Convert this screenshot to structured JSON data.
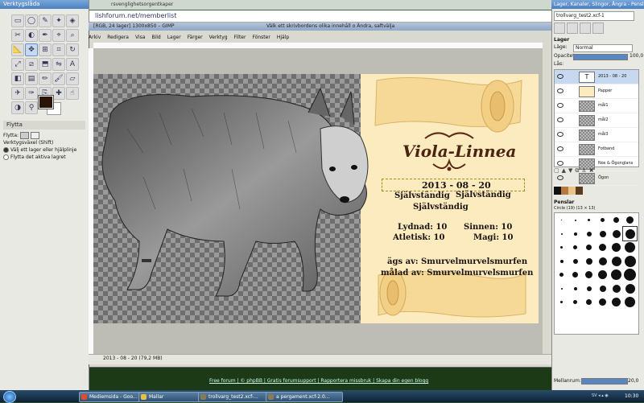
{
  "background_web": {
    "url": "lishforum.net/memberlist",
    "tab_label": "rsvenglighetsorgentkaper",
    "footer_links": "Free forum | © phpBB | Gratis forumsupport | Rapportera missbruk | Skapa din egen blogg"
  },
  "toolbox": {
    "title": "Verktygslåda",
    "options_title": "Flytta",
    "move_label": "Flytta:",
    "tool_switch_label": "Verktygsväxel (Shift)",
    "option_1": "Välj ett lager eller hjälplinje",
    "option_2": "Flytta det aktiva lagret",
    "tools": [
      "rect-select",
      "ellipse-select",
      "free-select",
      "fuzzy-select",
      "select-by-color",
      "scissors",
      "foreground-select",
      "paths",
      "color-picker",
      "zoom",
      "measure",
      "move",
      "align",
      "crop",
      "rotate",
      "scale",
      "shear",
      "perspective",
      "flip",
      "text",
      "bucket-fill",
      "blend",
      "pencil",
      "paintbrush",
      "eraser",
      "airbrush",
      "ink",
      "clone",
      "heal",
      "smudge",
      "dodge-burn",
      "dodge"
    ]
  },
  "image_window": {
    "title": "[RGB, 24 lager] 1300x850 – GIMP",
    "sub_title": "Välk ett skrivbordens olika innehåll o Ändra, saftvälja",
    "menu": [
      "Arkiv",
      "Redigera",
      "Visa",
      "Bild",
      "Lager",
      "Färger",
      "Verktyg",
      "Filter",
      "Fönster",
      "Hjälp"
    ],
    "status": "2013 - 08 - 20 (79,2 MB)"
  },
  "scroll": {
    "name": "Viola-Linnea",
    "date": "2013 - 08 - 20",
    "status_1": "Självständig",
    "status_2": "Självständig",
    "status_3": "Självständig",
    "lydnad": "Lydnad:  10",
    "atletisk": "Atletisk:  10",
    "sinnen": "Sinnen:  10",
    "magi": "Magi:  10",
    "owner": "ägs av: Smurvelmurvelsmurfen",
    "painter": "målad av: Smurvelmurvelsmurfen"
  },
  "dock": {
    "title": "Lager, Kanaler, Slingor, Ångra - Penslar, ...",
    "image_select": "trollvarg_test2.xcf-1",
    "layers_label": "Lager",
    "mode_label": "Läge:",
    "mode_value": "Normal",
    "opacity_label": "Opacitet:",
    "opacity_value": "100,0",
    "lock_label": "Lås:",
    "layers": [
      {
        "name": "2013 - 08 - 20",
        "kind": "text"
      },
      {
        "name": "Papper",
        "kind": "paper"
      },
      {
        "name": "mål1",
        "kind": "check"
      },
      {
        "name": "mål2",
        "kind": "check"
      },
      {
        "name": "mål3",
        "kind": "check"
      },
      {
        "name": "Fotband",
        "kind": "check"
      },
      {
        "name": "Nos & Ögonglans",
        "kind": "check"
      },
      {
        "name": "Ögon",
        "kind": "check"
      }
    ],
    "brushes_title": "Penslar",
    "brush_current": "Circle (19) (13 × 13)",
    "spacing_label": "Mellanrum:",
    "spacing_value": "20,0"
  },
  "taskbar": {
    "items": [
      "Mediemsida - Goo...",
      "Mallar",
      "trollvarg_test2.xcf-...",
      "a pergament.xcf-2.0..."
    ],
    "tray": "SV ◂ ▴ ◉",
    "clock": "10:30"
  },
  "colors": {
    "foreground": "#2b1308",
    "background": "#ffffff",
    "parchment": "#fdebc0"
  }
}
